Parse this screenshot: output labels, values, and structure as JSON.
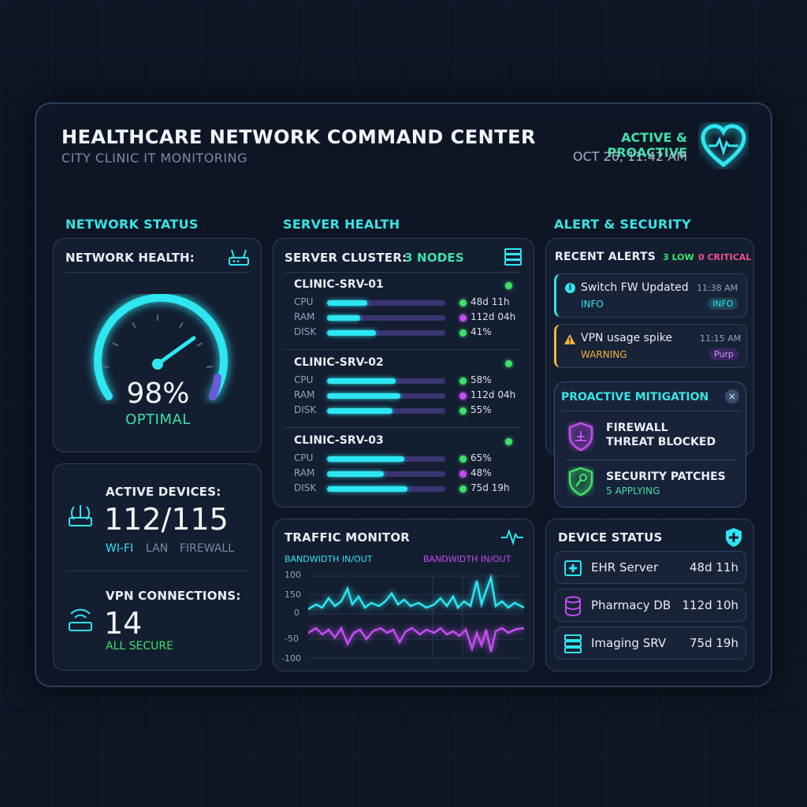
{
  "header": {
    "title": "HEALTHCARE NETWORK COMMAND CENTER",
    "subtitle": "CITY CLINIC IT MONITORING",
    "status": "ACTIVE & PROACTIVE",
    "datetime": "OCT 26, 11:42 AM"
  },
  "network": {
    "section_title": "NETWORK STATUS",
    "health_title": "NETWORK HEALTH:",
    "health_value": "98%",
    "health_fraction": 0.98,
    "health_state": "OPTIMAL",
    "active_devices_label": "ACTIVE DEVICES:",
    "active_devices_value": "112/115",
    "device_types": [
      "WI-FI",
      "LAN",
      "FIREWALL"
    ],
    "vpn_label": "VPN CONNECTIONS:",
    "vpn_value": "14",
    "vpn_status": "ALL SECURE"
  },
  "servers": {
    "section_title": "SERVER HEALTH",
    "cluster_label": "SERVER CLUSTER:",
    "cluster_count": "3 NODES",
    "nodes": [
      {
        "name": "CLINIC-SRV-01",
        "rows": [
          {
            "label": "CPU",
            "fill": 0.34,
            "value": "48d 11h",
            "dot": "green"
          },
          {
            "label": "RAM",
            "fill": 0.28,
            "value": "112d 04h",
            "dot": "purple"
          },
          {
            "label": "DISK",
            "fill": 0.41,
            "value": "41%",
            "dot": "green"
          }
        ]
      },
      {
        "name": "CLINIC-SRV-02",
        "rows": [
          {
            "label": "CPU",
            "fill": 0.58,
            "value": "58%",
            "dot": "green"
          },
          {
            "label": "RAM",
            "fill": 0.62,
            "value": "112d 04h",
            "dot": "purple"
          },
          {
            "label": "DISK",
            "fill": 0.55,
            "value": "55%",
            "dot": "green"
          }
        ]
      },
      {
        "name": "CLINIC-SRV-03",
        "rows": [
          {
            "label": "CPU",
            "fill": 0.65,
            "value": "65%",
            "dot": "green"
          },
          {
            "label": "RAM",
            "fill": 0.48,
            "value": "48%",
            "dot": "purple"
          },
          {
            "label": "DISK",
            "fill": 0.68,
            "value": "75d 19h",
            "dot": "green"
          }
        ]
      }
    ]
  },
  "traffic": {
    "title": "TRAFFIC MONITOR",
    "legend_in": "BANDWIDTH IN/OUT",
    "legend_out": "BANDWIDTH IN/OUT",
    "y_ticks": [
      "100",
      "150",
      "0",
      "-50",
      "-100"
    ],
    "in_color": "#2ee6f0",
    "out_color": "#c34ef0"
  },
  "alerts": {
    "section_title": "ALERT & SECURITY",
    "recent_title": "RECENT ALERTS",
    "low_count": "3 LOW",
    "critical_count": "0 CRITICAL",
    "items": [
      {
        "title": "Switch FW Updated",
        "time": "11:38 AM",
        "level": "INFO",
        "badge": "INFO",
        "icon": "info-icon"
      },
      {
        "title": "VPN usage spike",
        "time": "11:15 AM",
        "level": "WARNING",
        "badge": "Purp",
        "icon": "warning-icon"
      }
    ],
    "mitigation_title": "PROACTIVE MITIGATION",
    "mitigation_items": [
      {
        "line1": "FIREWALL",
        "line2": "THREAT BLOCKED"
      },
      {
        "line1": "SECURITY PATCHES",
        "line2": "5 APPLYING"
      }
    ]
  },
  "devices": {
    "title": "DEVICE STATUS",
    "items": [
      {
        "name": "EHR Server",
        "value": "48d 11h",
        "icon": "medical-server-icon"
      },
      {
        "name": "Pharmacy DB",
        "value": "112d 10h",
        "icon": "database-icon"
      },
      {
        "name": "Imaging SRV",
        "value": "75d 19h",
        "icon": "server-stack-icon"
      }
    ]
  },
  "colors": {
    "accent": "#38e4e4",
    "green": "#3fe06a",
    "purple": "#c34ef0",
    "warning": "#f3b53c",
    "critical": "#f0508c"
  }
}
